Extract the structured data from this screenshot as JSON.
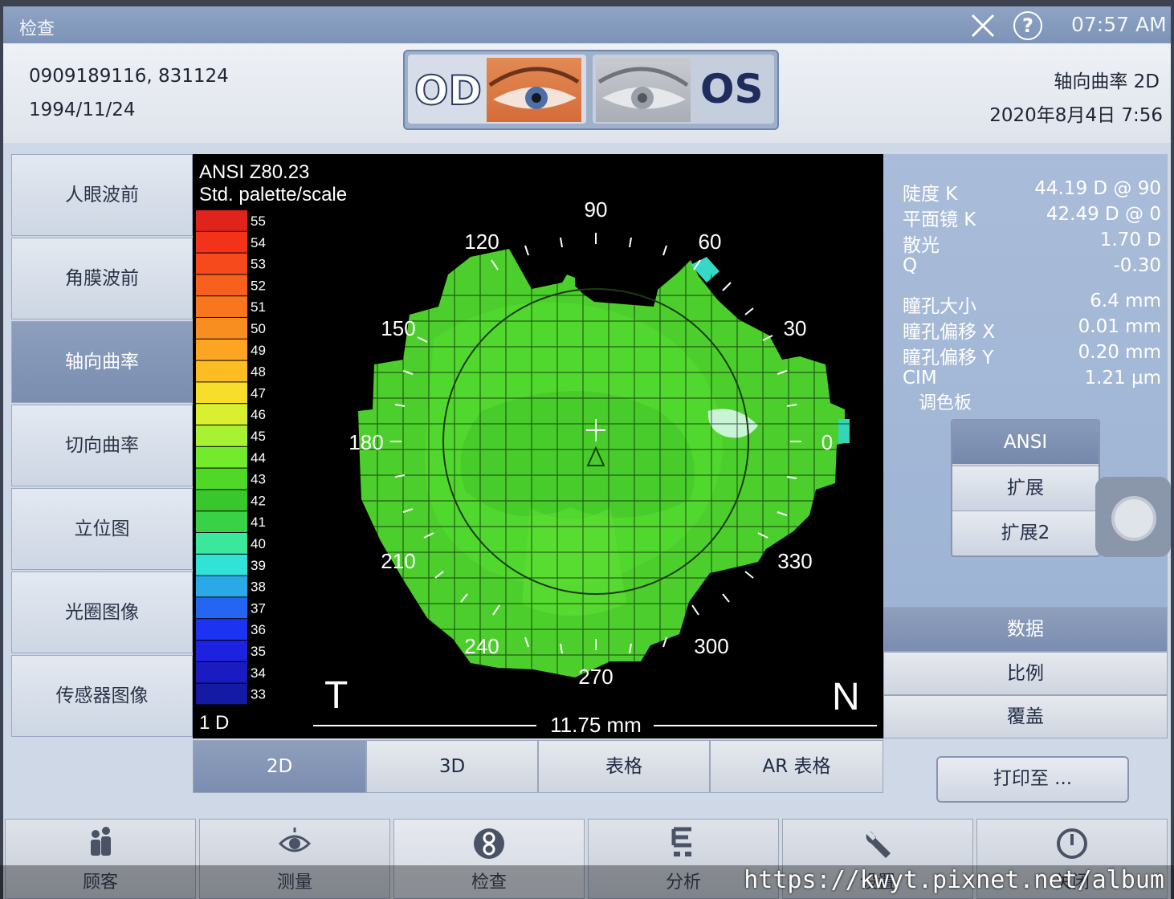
{
  "titlebar": {
    "title": "检查",
    "time": "07:57 AM",
    "help_glyph": "?"
  },
  "patient": {
    "id_line": "0909189116, 831124",
    "birthdate": "1994/11/24"
  },
  "eye_selector": {
    "od": "OD",
    "os": "OS",
    "selected": "OD"
  },
  "exam": {
    "mode": "轴向曲率 2D",
    "datetime": "2020年8月4日 7:56"
  },
  "left_nav": {
    "items": [
      {
        "label": "人眼波前",
        "active": false
      },
      {
        "label": "角膜波前",
        "active": false
      },
      {
        "label": "轴向曲率",
        "active": true
      },
      {
        "label": "切向曲率",
        "active": false
      },
      {
        "label": "立位图",
        "active": false
      },
      {
        "label": "光圈图像",
        "active": false
      },
      {
        "label": "传感器图像",
        "active": false
      }
    ]
  },
  "map": {
    "standard": "ANSI Z80.23",
    "palette_label": "Std. palette/scale",
    "step": "1 D",
    "scale_values": [
      "55",
      "54",
      "53",
      "52",
      "51",
      "50",
      "49",
      "48",
      "47",
      "46",
      "45",
      "44",
      "43",
      "42",
      "41",
      "40",
      "39",
      "38",
      "37",
      "36",
      "35",
      "34",
      "33"
    ],
    "scale_colors": [
      "#e0231b",
      "#f2331a",
      "#f64a1c",
      "#f7601d",
      "#f8771e",
      "#f98e20",
      "#fba522",
      "#fcbd23",
      "#f7de2a",
      "#d8f02f",
      "#a6f233",
      "#74ea2c",
      "#4fd926",
      "#39c82b",
      "#39d146",
      "#3be79a",
      "#31e2d6",
      "#2aa9e6",
      "#2466f2",
      "#1d33f2",
      "#1d22de",
      "#1a1cc2",
      "#151aa4"
    ],
    "angles": [
      "90",
      "120",
      "60",
      "150",
      "30",
      "180",
      "0",
      "210",
      "330",
      "240",
      "300",
      "270"
    ],
    "temporal": "T",
    "nasal": "N",
    "diameter": "11.75 mm"
  },
  "readings": [
    {
      "label": "陡度 K",
      "value": "44.19 D @ 90"
    },
    {
      "label": "平面镜 K",
      "value": "42.49 D @ 0"
    },
    {
      "label": "散光",
      "value": "1.70 D"
    },
    {
      "label": "Q",
      "value": "-0.30"
    },
    {
      "label": "瞳孔大小",
      "value": "6.4 mm"
    },
    {
      "label": "瞳孔偏移 X",
      "value": "0.01 mm"
    },
    {
      "label": "瞳孔偏移 Y",
      "value": "0.20 mm"
    },
    {
      "label": "CIM",
      "value": "1.21 µm"
    }
  ],
  "palette_section": {
    "title": "调色板",
    "options": [
      "ANSI",
      "扩展",
      "扩展2"
    ],
    "selected": "ANSI"
  },
  "right_tabs": {
    "items": [
      "数据",
      "比例",
      "覆盖"
    ],
    "selected": "数据"
  },
  "view_tabs": {
    "items": [
      "2D",
      "3D",
      "表格",
      "AR 表格"
    ],
    "selected": "2D"
  },
  "print_button": "打印至 ...",
  "bottom_nav": {
    "items": [
      "顾客",
      "测量",
      "检查",
      "分析",
      "设置",
      "关闭"
    ]
  },
  "watermark": "https://kwyt.pixnet.net/album",
  "colors": {
    "accent": "#7b8db0",
    "map_background": "#000000"
  }
}
